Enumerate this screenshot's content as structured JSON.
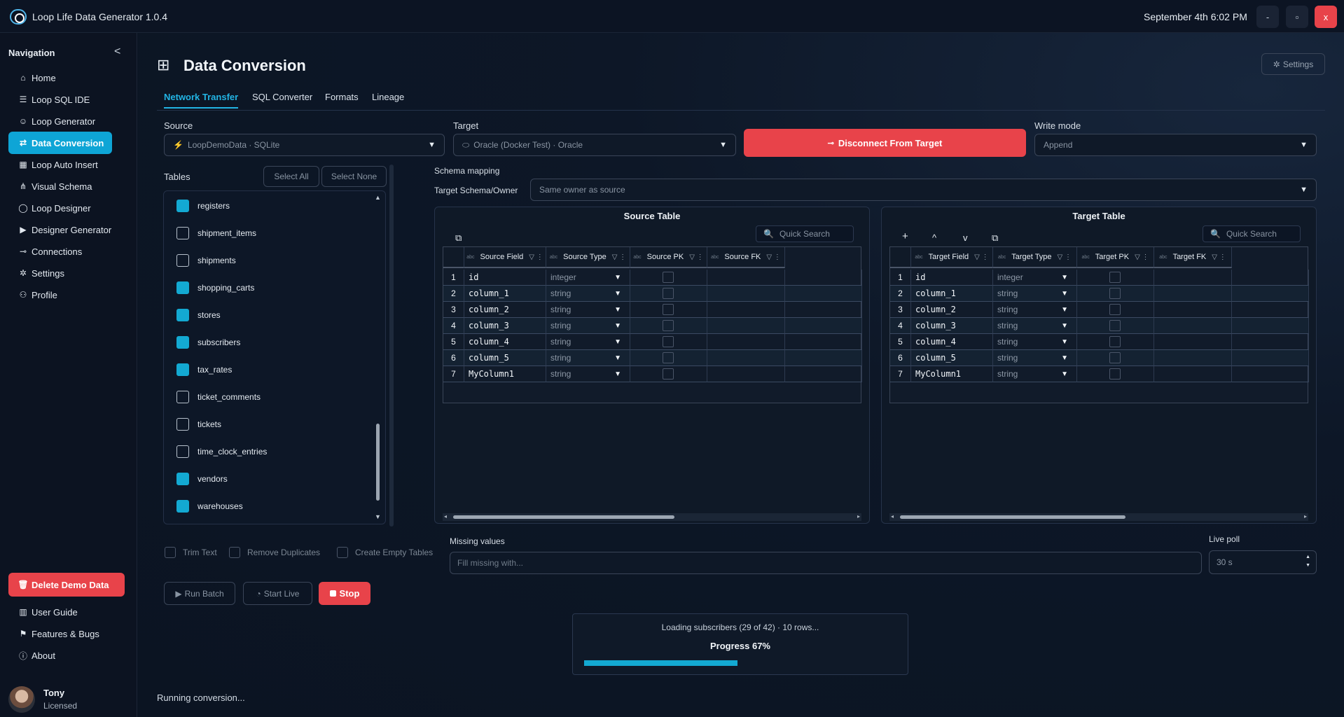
{
  "app": {
    "title": "Loop Life Data Generator 1.0.4",
    "datetime": "September 4th 6:02 PM",
    "win_min": "-",
    "win_max": "▫",
    "win_close": "x"
  },
  "nav": {
    "heading": "Navigation",
    "collapse": "<",
    "items": [
      {
        "label": "Home",
        "icon": "home-icon"
      },
      {
        "label": "Loop SQL IDE",
        "icon": "database-icon"
      },
      {
        "label": "Loop Generator",
        "icon": "users-icon"
      },
      {
        "label": "Data Conversion",
        "icon": "conversion-icon",
        "active": true
      },
      {
        "label": "Loop Auto Insert",
        "icon": "table-icon"
      },
      {
        "label": "Visual Schema",
        "icon": "schema-icon"
      },
      {
        "label": "Loop Designer",
        "icon": "loop-icon"
      },
      {
        "label": "Designer Generator",
        "icon": "play-icon"
      },
      {
        "label": "Connections",
        "icon": "plug-icon"
      },
      {
        "label": "Settings",
        "icon": "gear-icon"
      },
      {
        "label": "Profile",
        "icon": "user-icon"
      }
    ],
    "delete_demo": "Delete Demo Data",
    "bottom": [
      {
        "label": "User Guide",
        "icon": "book-icon"
      },
      {
        "label": "Features & Bugs",
        "icon": "flag-icon"
      },
      {
        "label": "About",
        "icon": "info-icon"
      }
    ],
    "user": {
      "name": "Tony",
      "license": "Licensed"
    }
  },
  "page": {
    "title": "Data Conversion",
    "settings_button": "Settings",
    "tabs": [
      "Network Transfer",
      "SQL Converter",
      "Formats",
      "Lineage"
    ],
    "active_tab": "Network Transfer"
  },
  "form": {
    "source_label": "Source",
    "source_value": "LoopDemoData · SQLite",
    "target_label": "Target",
    "target_value": "Oracle (Docker Test) · Oracle",
    "disconnect_button": "Disconnect From Target",
    "write_mode_label": "Write mode",
    "write_mode_value": "Append",
    "tables_label": "Tables",
    "select_all": "Select All",
    "select_none": "Select None",
    "schema_mapping_label": "Schema mapping",
    "target_schema_label": "Target Schema/Owner",
    "target_schema_placeholder": "Same owner as source"
  },
  "tables": [
    {
      "name": "registers",
      "checked": true
    },
    {
      "name": "shipment_items",
      "checked": false
    },
    {
      "name": "shipments",
      "checked": false
    },
    {
      "name": "shopping_carts",
      "checked": true
    },
    {
      "name": "stores",
      "checked": true
    },
    {
      "name": "subscribers",
      "checked": true
    },
    {
      "name": "tax_rates",
      "checked": true
    },
    {
      "name": "ticket_comments",
      "checked": false
    },
    {
      "name": "tickets",
      "checked": false
    },
    {
      "name": "time_clock_entries",
      "checked": false
    },
    {
      "name": "vendors",
      "checked": true
    },
    {
      "name": "warehouses",
      "checked": true
    }
  ],
  "source_table": {
    "title": "Source Table",
    "search_placeholder": "Quick Search",
    "headers": [
      "Source Field",
      "Source Type",
      "Source PK",
      "Source FK"
    ],
    "rows": [
      {
        "n": "1",
        "field": "id",
        "type": "integer"
      },
      {
        "n": "2",
        "field": "column_1",
        "type": "string"
      },
      {
        "n": "3",
        "field": "column_2",
        "type": "string"
      },
      {
        "n": "4",
        "field": "column_3",
        "type": "string"
      },
      {
        "n": "5",
        "field": "column_4",
        "type": "string"
      },
      {
        "n": "6",
        "field": "column_5",
        "type": "string"
      },
      {
        "n": "7",
        "field": "MyColumn1",
        "type": "string"
      }
    ]
  },
  "target_table": {
    "title": "Target Table",
    "search_placeholder": "Quick Search",
    "headers": [
      "Target Field",
      "Target Type",
      "Target PK",
      "Target FK"
    ],
    "tools": [
      "+",
      "^",
      "v"
    ],
    "rows": [
      {
        "n": "1",
        "field": "id",
        "type": "integer"
      },
      {
        "n": "2",
        "field": "column_1",
        "type": "string"
      },
      {
        "n": "3",
        "field": "column_2",
        "type": "string"
      },
      {
        "n": "4",
        "field": "column_3",
        "type": "string"
      },
      {
        "n": "5",
        "field": "column_4",
        "type": "string"
      },
      {
        "n": "6",
        "field": "column_5",
        "type": "string"
      },
      {
        "n": "7",
        "field": "MyColumn1",
        "type": "string"
      }
    ]
  },
  "options": {
    "trim_text": "Trim Text",
    "remove_duplicates": "Remove Duplicates",
    "create_empty_tables": "Create Empty Tables",
    "missing_values_label": "Missing values",
    "missing_values_placeholder": "Fill missing with...",
    "live_poll_label": "Live poll",
    "live_poll_value": "30 s"
  },
  "actions": {
    "run_batch": "Run Batch",
    "start_live": "Start Live",
    "stop": "Stop"
  },
  "progress": {
    "message": "Loading subscribers (29 of 42) · 10 rows...",
    "label": "Progress 67%",
    "fraction": 0.67
  },
  "status": "Running conversion...",
  "colors": {
    "accent": "#13a9d2",
    "danger": "#e8434a"
  }
}
